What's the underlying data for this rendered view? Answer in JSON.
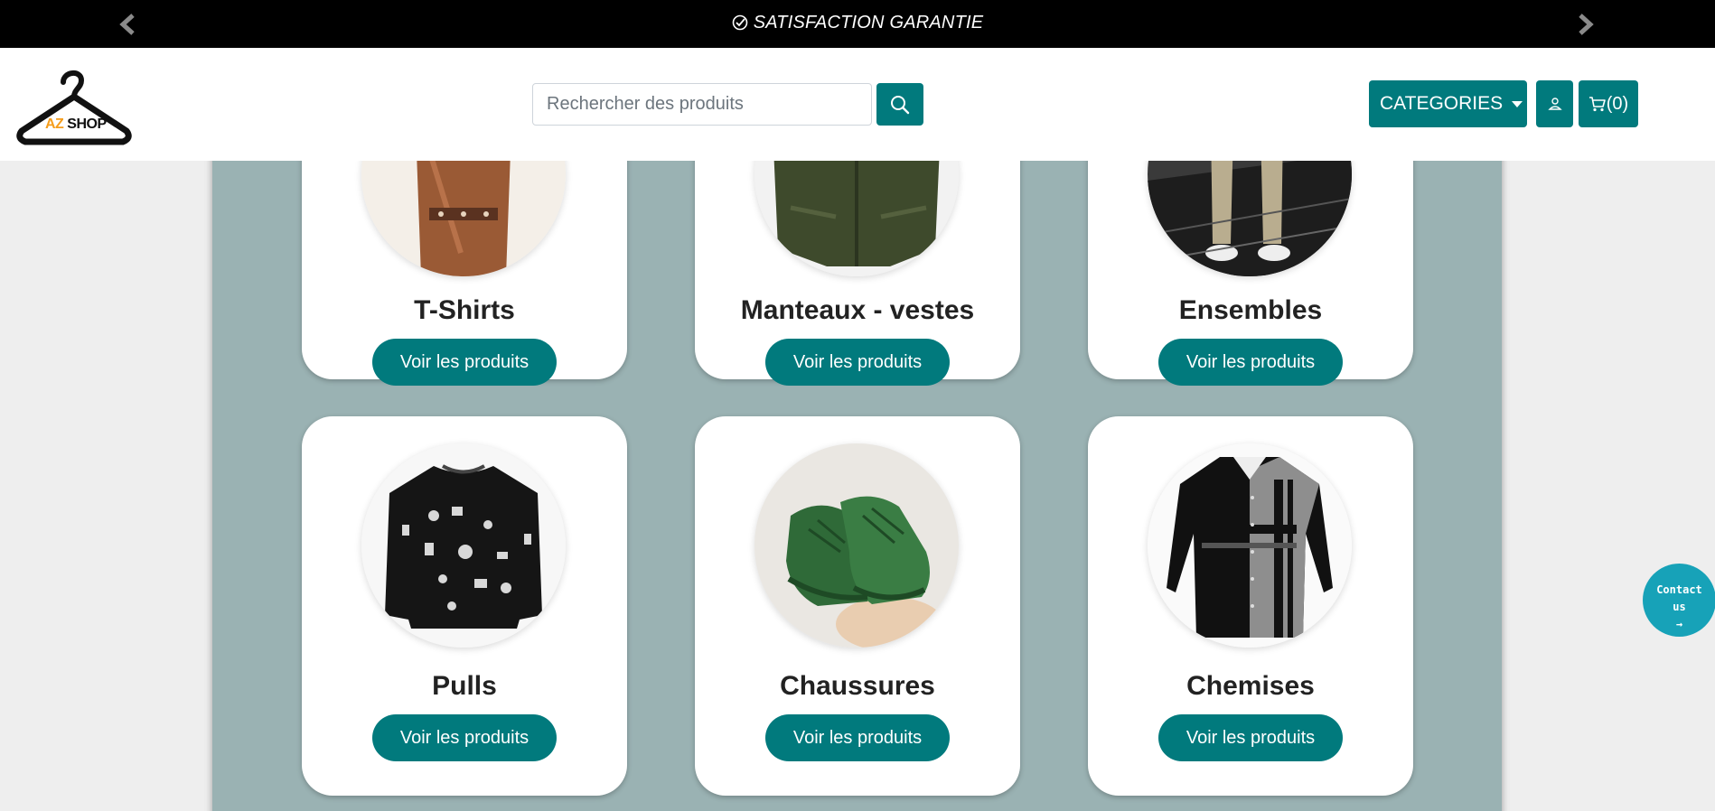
{
  "topbar": {
    "promo_text": "SATISFACTION GARANTIE",
    "prev_icon": "chevron-left-icon",
    "next_icon": "chevron-right-icon"
  },
  "header": {
    "logo_text_az": "AZ",
    "logo_text_shop": "SHOP",
    "search_placeholder": "Rechercher des produits",
    "categories_label": "CATEGORIES",
    "cart_label": "(0)"
  },
  "categories": [
    {
      "name": "T-Shirts",
      "button": "Voir les produits",
      "image": "guitar-shirt-photo"
    },
    {
      "name": "Manteaux - vestes",
      "button": "Voir les produits",
      "image": "green-jacket-photo"
    },
    {
      "name": "Ensembles",
      "button": "Voir les produits",
      "image": "outfit-sneakers-photo"
    },
    {
      "name": "Pulls",
      "button": "Voir les produits",
      "image": "black-sweater-photo"
    },
    {
      "name": "Chaussures",
      "button": "Voir les produits",
      "image": "green-sneakers-photo"
    },
    {
      "name": "Chemises",
      "button": "Voir les produits",
      "image": "black-grey-shirt-photo"
    }
  ],
  "contact": {
    "line1": "Contact",
    "line2": "us",
    "arrow": "→"
  },
  "colors": {
    "accent": "#017a7d",
    "panel": "#9ab2b3",
    "contact": "#17a2b8",
    "logo_orange": "#f59d1c"
  }
}
